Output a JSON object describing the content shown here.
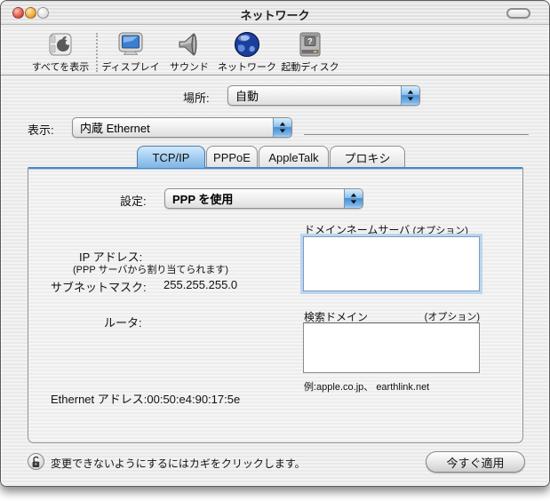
{
  "window": {
    "title": "ネットワーク"
  },
  "toolbar": {
    "items": [
      {
        "label": "すべてを表示",
        "icon": "show-all-apple-icon"
      },
      {
        "label": "ディスプレイ",
        "icon": "display-icon"
      },
      {
        "label": "サウンド",
        "icon": "sound-speaker-icon"
      },
      {
        "label": "ネットワーク",
        "icon": "network-globe-icon"
      },
      {
        "label": "起動ディスク",
        "icon": "startup-disk-icon"
      }
    ]
  },
  "location": {
    "label": "場所:",
    "value": "自動"
  },
  "show": {
    "label": "表示:",
    "value": "内蔵 Ethernet"
  },
  "tabs": [
    {
      "label": "TCP/IP",
      "selected": true
    },
    {
      "label": "PPPoE",
      "selected": false
    },
    {
      "label": "AppleTalk",
      "selected": false
    },
    {
      "label": "プロキシ",
      "selected": false
    }
  ],
  "panel": {
    "configure": {
      "label": "設定:",
      "value": "PPP を使用"
    },
    "dns": {
      "label": "ドメインネームサーバ",
      "optional": "(オプション)",
      "value": ""
    },
    "ip": {
      "label": "IP アドレス:",
      "note": "(PPP サーバから割り当てられます)"
    },
    "subnet": {
      "label": "サブネットマスク:",
      "value": "255.255.255.0"
    },
    "router": {
      "label": "ルータ:"
    },
    "search": {
      "label": "検索ドメイン",
      "optional": "(オプション)",
      "value": "",
      "example": "例:apple.co.jp、 earthlink.net"
    },
    "ethernet": {
      "label": "Ethernet アドレス:",
      "value": "00:50:e4:90:17:5e"
    }
  },
  "footer": {
    "lock_text": "変更できないようにするにはカギをクリックします。",
    "apply_label": "今すぐ適用"
  },
  "colors": {
    "aqua_accent": "#4d86c4",
    "tab_selected": "#a8d0f2",
    "close_red": "#e2574c",
    "minimize_yellow": "#f0a93a",
    "pinstripe_light": "#f3f3f3",
    "pinstripe_dark": "#e9e9e9"
  }
}
